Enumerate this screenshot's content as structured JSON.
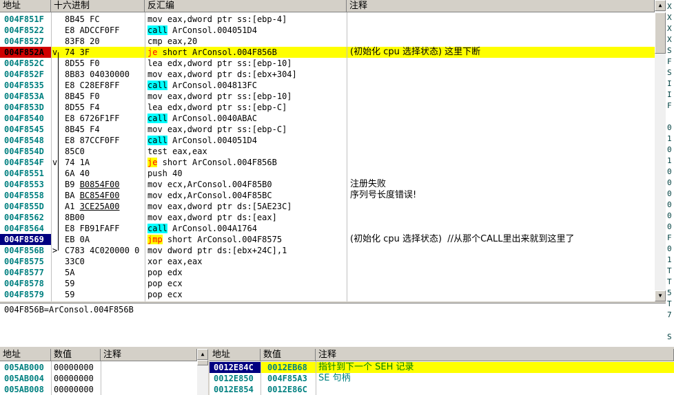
{
  "disasm": {
    "headers": {
      "address": "地址",
      "hex": "十六进制",
      "disasm": "反汇编",
      "comment": "注释"
    },
    "rows": [
      {
        "addr": "004F851F",
        "mark": "",
        "hex": [
          {
            "t": "8B45 FC"
          }
        ],
        "asm": [
          {
            "t": "mov eax,dword ptr ss:[ebp-4]"
          }
        ],
        "cmt": ""
      },
      {
        "addr": "004F8522",
        "mark": "",
        "hex": [
          {
            "t": "E8 ADCCF0FF"
          }
        ],
        "asm": [
          {
            "t": "call",
            "k": "call"
          },
          {
            "t": " ArConsol.004051D4"
          }
        ],
        "cmt": ""
      },
      {
        "addr": "004F8527",
        "mark": "",
        "hex": [
          {
            "t": "83F8 20"
          }
        ],
        "asm": [
          {
            "t": "cmp eax,20"
          }
        ],
        "cmt": ""
      },
      {
        "addr": "004F852A",
        "mark": "v",
        "addrStyle": "red",
        "hl": true,
        "hex": [
          {
            "t": "74 3F"
          }
        ],
        "asm": [
          {
            "t": "je",
            "k": "je"
          },
          {
            "t": " short ArConsol.004F856B"
          }
        ],
        "cmt": "(初始化 cpu 选择状态) 这里下断"
      },
      {
        "addr": "004F852C",
        "mark": "",
        "hex": [
          {
            "t": "8D55 F0"
          }
        ],
        "asm": [
          {
            "t": "lea edx,dword ptr ss:[ebp-10]"
          }
        ],
        "cmt": ""
      },
      {
        "addr": "004F852F",
        "mark": "",
        "hex": [
          {
            "t": "8B83 04030000"
          }
        ],
        "asm": [
          {
            "t": "mov eax,dword ptr ds:[ebx+304]"
          }
        ],
        "cmt": ""
      },
      {
        "addr": "004F8535",
        "mark": "",
        "hex": [
          {
            "t": "E8 C28EF8FF"
          }
        ],
        "asm": [
          {
            "t": "call",
            "k": "call"
          },
          {
            "t": " ArConsol.004813FC"
          }
        ],
        "cmt": ""
      },
      {
        "addr": "004F853A",
        "mark": "",
        "hex": [
          {
            "t": "8B45 F0"
          }
        ],
        "asm": [
          {
            "t": "mov eax,dword ptr ss:[ebp-10]"
          }
        ],
        "cmt": ""
      },
      {
        "addr": "004F853D",
        "mark": "",
        "hex": [
          {
            "t": "8D55 F4"
          }
        ],
        "asm": [
          {
            "t": "lea edx,dword ptr ss:[ebp-C]"
          }
        ],
        "cmt": ""
      },
      {
        "addr": "004F8540",
        "mark": "",
        "hex": [
          {
            "t": "E8 6726F1FF"
          }
        ],
        "asm": [
          {
            "t": "call",
            "k": "call"
          },
          {
            "t": " ArConsol.0040ABAC"
          }
        ],
        "cmt": ""
      },
      {
        "addr": "004F8545",
        "mark": "",
        "hex": [
          {
            "t": "8B45 F4"
          }
        ],
        "asm": [
          {
            "t": "mov eax,dword ptr ss:[ebp-C]"
          }
        ],
        "cmt": ""
      },
      {
        "addr": "004F8548",
        "mark": "",
        "hex": [
          {
            "t": "E8 87CCF0FF"
          }
        ],
        "asm": [
          {
            "t": "call",
            "k": "call"
          },
          {
            "t": " ArConsol.004051D4"
          }
        ],
        "cmt": ""
      },
      {
        "addr": "004F854D",
        "mark": "",
        "hex": [
          {
            "t": "85C0"
          }
        ],
        "asm": [
          {
            "t": "test eax,eax"
          }
        ],
        "cmt": ""
      },
      {
        "addr": "004F854F",
        "mark": "v",
        "hex": [
          {
            "t": "74 1A"
          }
        ],
        "asm": [
          {
            "t": "je",
            "k": "je"
          },
          {
            "t": " short ArConsol.004F856B"
          }
        ],
        "cmt": ""
      },
      {
        "addr": "004F8551",
        "mark": "",
        "hex": [
          {
            "t": "6A 40"
          }
        ],
        "asm": [
          {
            "t": "push 40"
          }
        ],
        "cmt": ""
      },
      {
        "addr": "004F8553",
        "mark": "",
        "hex": [
          {
            "t": "B9 "
          },
          {
            "t": "B0854F00",
            "u": true
          }
        ],
        "asm": [
          {
            "t": "mov ecx,ArConsol.004F85B0"
          }
        ],
        "cmt": "注册失败"
      },
      {
        "addr": "004F8558",
        "mark": "",
        "hex": [
          {
            "t": "BA "
          },
          {
            "t": "BC854F00",
            "u": true
          }
        ],
        "asm": [
          {
            "t": "mov edx,ArConsol.004F85BC"
          }
        ],
        "cmt": "序列号长度错误!"
      },
      {
        "addr": "004F855D",
        "mark": "",
        "hex": [
          {
            "t": "A1 "
          },
          {
            "t": "3CE25A00",
            "u": true
          }
        ],
        "asm": [
          {
            "t": "mov eax,dword ptr ds:[5AE23C]"
          }
        ],
        "cmt": ""
      },
      {
        "addr": "004F8562",
        "mark": "",
        "hex": [
          {
            "t": "8B00"
          }
        ],
        "asm": [
          {
            "t": "mov eax,dword ptr ds:[eax]"
          }
        ],
        "cmt": ""
      },
      {
        "addr": "004F8564",
        "mark": "",
        "hex": [
          {
            "t": "E8 FB91FAFF"
          }
        ],
        "asm": [
          {
            "t": "call",
            "k": "call"
          },
          {
            "t": " ArConsol.004A1764"
          }
        ],
        "cmt": ""
      },
      {
        "addr": "004F8569",
        "mark": "",
        "addrStyle": "navy",
        "hex": [
          {
            "t": "EB 0A"
          }
        ],
        "asm": [
          {
            "t": "jmp",
            "k": "jmp"
          },
          {
            "t": " short ArConsol.004F8575"
          }
        ],
        "cmt": "(初始化 cpu 选择状态)  //从那个CALL里出来就到这里了"
      },
      {
        "addr": "004F856B",
        "mark": ">",
        "hex": [
          {
            "t": "C783 4C020000 0"
          }
        ],
        "asm": [
          {
            "t": "mov dword ptr ds:[ebx+24C],1"
          }
        ],
        "cmt": ""
      },
      {
        "addr": "004F8575",
        "mark": "",
        "hex": [
          {
            "t": "33C0"
          }
        ],
        "asm": [
          {
            "t": "xor eax,eax"
          }
        ],
        "cmt": ""
      },
      {
        "addr": "004F8577",
        "mark": "",
        "hex": [
          {
            "t": "5A"
          }
        ],
        "asm": [
          {
            "t": "pop edx"
          }
        ],
        "cmt": ""
      },
      {
        "addr": "004F8578",
        "mark": "",
        "hex": [
          {
            "t": "59"
          }
        ],
        "asm": [
          {
            "t": "pop ecx"
          }
        ],
        "cmt": ""
      },
      {
        "addr": "004F8579",
        "mark": "",
        "hex": [
          {
            "t": "59"
          }
        ],
        "asm": [
          {
            "t": "pop ecx"
          }
        ],
        "cmt": ""
      }
    ]
  },
  "info": {
    "text": "004F856B=ArConsol.004F856B"
  },
  "dump": {
    "headers": {
      "address": "地址",
      "value": "数值",
      "comment": "注释"
    },
    "rows": [
      {
        "addr": "005AB000",
        "val": "00000000"
      },
      {
        "addr": "005AB004",
        "val": "00000000"
      },
      {
        "addr": "005AB008",
        "val": "00000000"
      }
    ]
  },
  "stack": {
    "headers": {
      "address": "地址",
      "value": "数值",
      "comment": "注释"
    },
    "rows": [
      {
        "addr": "0012E84C",
        "val": "0012EB68",
        "cmt": "指针到下一个 SEH 记录",
        "hl": true
      },
      {
        "addr": "0012E850",
        "val": "004F85A3",
        "cmt": "SE 句柄"
      },
      {
        "addr": "0012E854",
        "val": "0012E86C",
        "cmt": ""
      }
    ]
  },
  "registers_edge": [
    "X",
    "X",
    "X",
    "X",
    "S",
    "F",
    "S",
    "I",
    "I",
    "F",
    "",
    "0",
    "1",
    "0",
    "1",
    "0",
    "0",
    "0",
    "0",
    "0",
    "0",
    "F",
    "0",
    "1",
    "T",
    "T",
    "5",
    "T",
    "7",
    "",
    "S"
  ]
}
